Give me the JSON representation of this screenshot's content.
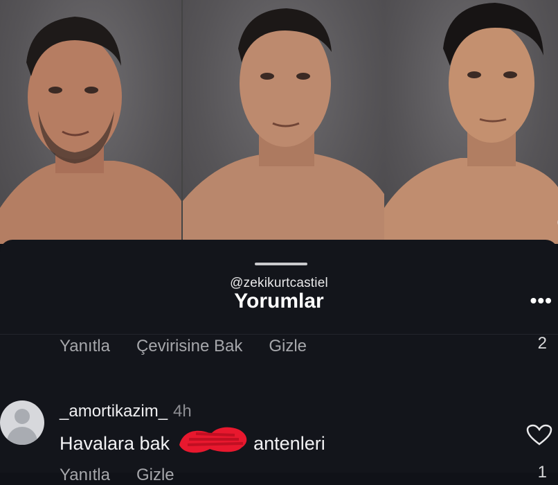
{
  "photos": [
    {
      "name": "photo-person-1"
    },
    {
      "name": "photo-person-2"
    },
    {
      "name": "photo-person-3"
    }
  ],
  "sheet": {
    "handle": "@zekikurtcastiel",
    "title": "Yorumlar",
    "more": "•••"
  },
  "prev_comment": {
    "actions": [
      "Yanıtla",
      "Çevirisine Bak",
      "Gizle"
    ],
    "like_count": "2"
  },
  "comment": {
    "username": "_amortikazim_",
    "time": "4h",
    "text_before": "Havalara bak",
    "text_after": "antenleri",
    "actions": [
      "Yanıtla",
      "Gizle"
    ],
    "like_count": "1"
  },
  "colors": {
    "background": "#13151b",
    "scribble": "#e8182e"
  },
  "icons": [
    "heart-outline-icon",
    "avatar-placeholder-icon",
    "more-dots-icon"
  ]
}
